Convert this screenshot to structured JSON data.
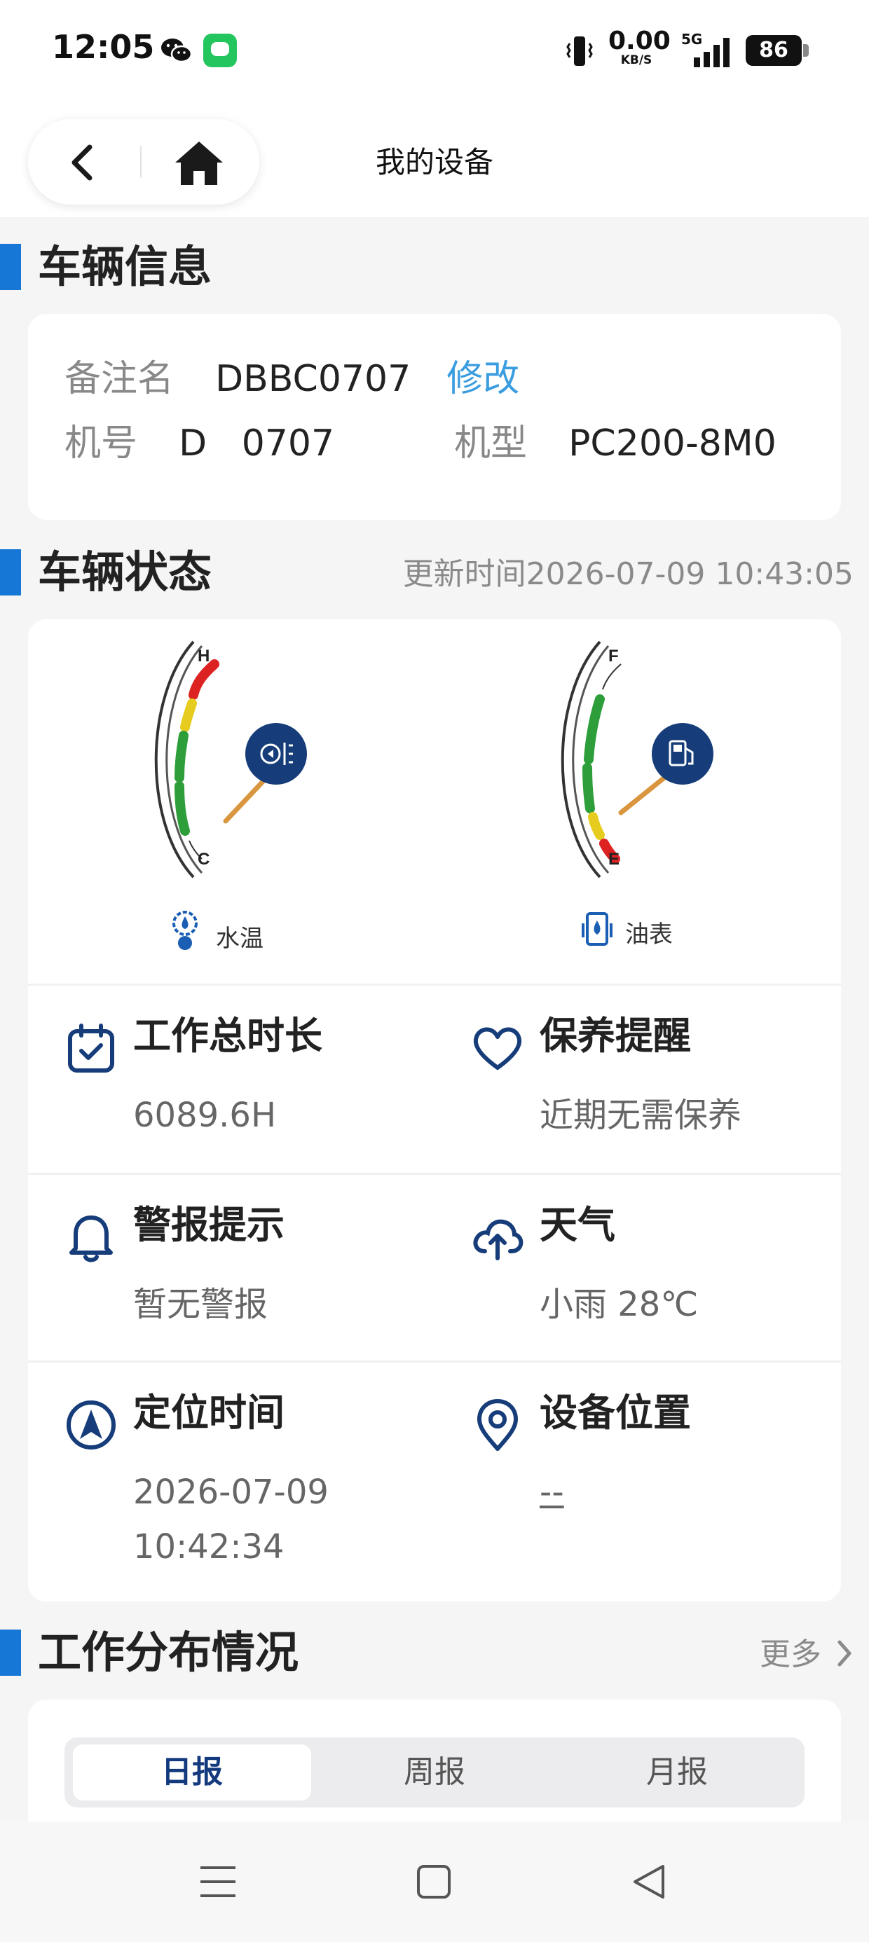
{
  "status_bar": {
    "time": "12:05",
    "net_speed_value": "0.00",
    "net_speed_unit": "KB/S",
    "network": "5G",
    "battery": "86"
  },
  "nav": {
    "title": "我的设备"
  },
  "vehicle_info": {
    "section_title": "车辆信息",
    "remark_label": "备注名",
    "remark_value": "DBBC0707",
    "edit_label": "修改",
    "machine_no_label": "机号",
    "machine_no_value": "D   0707",
    "model_label": "机型",
    "model_value": "PC200-8M0"
  },
  "vehicle_status": {
    "section_title": "车辆状态",
    "update_time": "更新时间2026-07-09 10:43:05",
    "water_temp": {
      "label": "水温",
      "high_mark": "H",
      "low_mark": "C"
    },
    "fuel": {
      "label": "油表",
      "full_mark": "F",
      "empty_mark": "E"
    },
    "cells": [
      {
        "title": "工作总时长",
        "value": "6089.6H",
        "icon": "calendar-check-icon"
      },
      {
        "title": "保养提醒",
        "value": "近期无需保养",
        "icon": "heart-icon"
      },
      {
        "title": "警报提示",
        "value": "暂无警报",
        "icon": "bell-icon"
      },
      {
        "title": "天气",
        "value": "小雨 28℃",
        "icon": "cloud-upload-icon"
      },
      {
        "title": "定位时间",
        "value_line1": "2026-07-09",
        "value_line2": "10:42:34",
        "icon": "navigation-arrow-icon"
      },
      {
        "title": "设备位置",
        "value": "--",
        "icon": "location-pin-icon"
      }
    ]
  },
  "work_distribution": {
    "section_title": "工作分布情况",
    "more_label": "更多",
    "tabs": [
      "日报",
      "周报",
      "月报"
    ],
    "active_tab": "日报"
  },
  "colors": {
    "accent_blue": "#1677d6",
    "link_blue": "#3a9de0",
    "icon_navy": "#163d7a",
    "gauge_green": "#2e9e3a",
    "gauge_yellow": "#e6cc1e",
    "gauge_red": "#dd2222",
    "needle_orange": "#d9963f"
  }
}
